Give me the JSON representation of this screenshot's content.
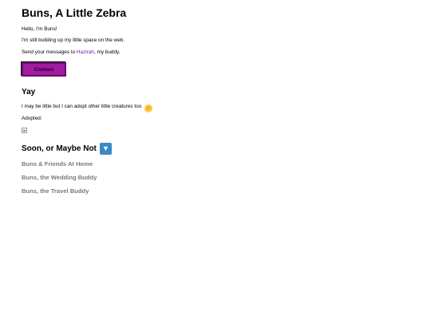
{
  "header": {
    "title": "Buns, A Little Zebra"
  },
  "intro": {
    "line1": "Hello, I'm Buns!",
    "line2": "I'm still building up my little space on the web.",
    "line3_prefix": "Send your messages to ",
    "line3_link": "Hazirah",
    "line3_suffix": ", my buddy."
  },
  "contact_button": {
    "label": "Contact"
  },
  "yay_section": {
    "title": "Yay",
    "adopt_text": "I may be little but I can adopt other little creatures too",
    "emoji": "smiling-face-emoji",
    "adopted_label": "Adopted:"
  },
  "soon_section": {
    "title": "Soon, or Maybe Not",
    "icon": "down-arrow-button-emoji",
    "items": [
      "Buns & Friends At Home",
      "Buns, the Wedding Buddy",
      "Buns, the Travel Buddy"
    ]
  },
  "colors": {
    "accent_button": "#a21aa1",
    "link": "#5b1fa6",
    "muted_text": "#7a7a7a",
    "down_arrow_bg": "#3b88c3"
  }
}
